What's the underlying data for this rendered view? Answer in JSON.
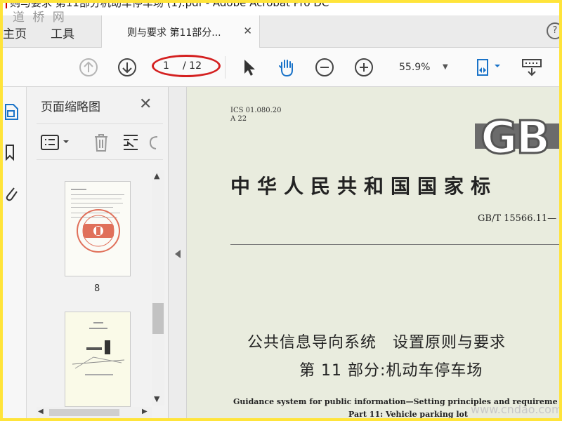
{
  "window": {
    "title": "则与要求 第11部分机动车停车场 (1).pdf - Adobe Acrobat Pro DC",
    "watermark_top": "道 桥 网",
    "watermark_bottom": "www.cndao.com"
  },
  "tabs": {
    "home": "主页",
    "tools": "工具",
    "document": "则与要求 第11部分...",
    "close": "✕",
    "help": "?"
  },
  "toolbar": {
    "page_current": "1",
    "page_total": "/ 12",
    "zoom": "55.9%",
    "zoom_caret": "▼",
    "icons": [
      "prev-page-icon",
      "next-page-icon",
      "select-cursor-icon",
      "hand-tool-icon",
      "zoom-out-icon",
      "zoom-in-icon",
      "page-fit-icon",
      "keyboard-icon"
    ],
    "accent": "#1a73c8"
  },
  "thumbnails": {
    "header": "页面缩略图",
    "close": "✕",
    "page_label": "8",
    "scroll_up": "▲",
    "scroll_down": "▼",
    "scroll_left": "◀",
    "scroll_right": "▶"
  },
  "document": {
    "ics": "ICS 01.080.20",
    "class_code": "A 22",
    "logo": "GB",
    "national_standard": "中华人民共和国国家标",
    "standard_no": "GB/T 15566.11—",
    "title_line1": "公共信息导向系统　设置原则与要求",
    "title_line2": "第 11 部分:机动车停车场",
    "english_line1": "Guidance system for public information—Setting principles and requireme",
    "english_line2": "Part 11: Vehicle parking lot"
  }
}
